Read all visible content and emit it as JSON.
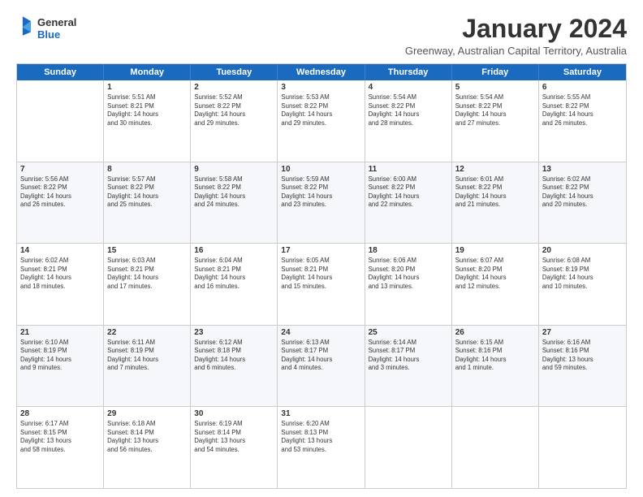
{
  "logo": {
    "general": "General",
    "blue": "Blue"
  },
  "title": "January 2024",
  "subtitle": "Greenway, Australian Capital Territory, Australia",
  "header_days": [
    "Sunday",
    "Monday",
    "Tuesday",
    "Wednesday",
    "Thursday",
    "Friday",
    "Saturday"
  ],
  "rows": [
    {
      "alt": false,
      "cells": [
        {
          "day": "",
          "info": ""
        },
        {
          "day": "1",
          "info": "Sunrise: 5:51 AM\nSunset: 8:21 PM\nDaylight: 14 hours\nand 30 minutes."
        },
        {
          "day": "2",
          "info": "Sunrise: 5:52 AM\nSunset: 8:22 PM\nDaylight: 14 hours\nand 29 minutes."
        },
        {
          "day": "3",
          "info": "Sunrise: 5:53 AM\nSunset: 8:22 PM\nDaylight: 14 hours\nand 29 minutes."
        },
        {
          "day": "4",
          "info": "Sunrise: 5:54 AM\nSunset: 8:22 PM\nDaylight: 14 hours\nand 28 minutes."
        },
        {
          "day": "5",
          "info": "Sunrise: 5:54 AM\nSunset: 8:22 PM\nDaylight: 14 hours\nand 27 minutes."
        },
        {
          "day": "6",
          "info": "Sunrise: 5:55 AM\nSunset: 8:22 PM\nDaylight: 14 hours\nand 26 minutes."
        }
      ]
    },
    {
      "alt": true,
      "cells": [
        {
          "day": "7",
          "info": "Sunrise: 5:56 AM\nSunset: 8:22 PM\nDaylight: 14 hours\nand 26 minutes."
        },
        {
          "day": "8",
          "info": "Sunrise: 5:57 AM\nSunset: 8:22 PM\nDaylight: 14 hours\nand 25 minutes."
        },
        {
          "day": "9",
          "info": "Sunrise: 5:58 AM\nSunset: 8:22 PM\nDaylight: 14 hours\nand 24 minutes."
        },
        {
          "day": "10",
          "info": "Sunrise: 5:59 AM\nSunset: 8:22 PM\nDaylight: 14 hours\nand 23 minutes."
        },
        {
          "day": "11",
          "info": "Sunrise: 6:00 AM\nSunset: 8:22 PM\nDaylight: 14 hours\nand 22 minutes."
        },
        {
          "day": "12",
          "info": "Sunrise: 6:01 AM\nSunset: 8:22 PM\nDaylight: 14 hours\nand 21 minutes."
        },
        {
          "day": "13",
          "info": "Sunrise: 6:02 AM\nSunset: 8:22 PM\nDaylight: 14 hours\nand 20 minutes."
        }
      ]
    },
    {
      "alt": false,
      "cells": [
        {
          "day": "14",
          "info": "Sunrise: 6:02 AM\nSunset: 8:21 PM\nDaylight: 14 hours\nand 18 minutes."
        },
        {
          "day": "15",
          "info": "Sunrise: 6:03 AM\nSunset: 8:21 PM\nDaylight: 14 hours\nand 17 minutes."
        },
        {
          "day": "16",
          "info": "Sunrise: 6:04 AM\nSunset: 8:21 PM\nDaylight: 14 hours\nand 16 minutes."
        },
        {
          "day": "17",
          "info": "Sunrise: 6:05 AM\nSunset: 8:21 PM\nDaylight: 14 hours\nand 15 minutes."
        },
        {
          "day": "18",
          "info": "Sunrise: 6:06 AM\nSunset: 8:20 PM\nDaylight: 14 hours\nand 13 minutes."
        },
        {
          "day": "19",
          "info": "Sunrise: 6:07 AM\nSunset: 8:20 PM\nDaylight: 14 hours\nand 12 minutes."
        },
        {
          "day": "20",
          "info": "Sunrise: 6:08 AM\nSunset: 8:19 PM\nDaylight: 14 hours\nand 10 minutes."
        }
      ]
    },
    {
      "alt": true,
      "cells": [
        {
          "day": "21",
          "info": "Sunrise: 6:10 AM\nSunset: 8:19 PM\nDaylight: 14 hours\nand 9 minutes."
        },
        {
          "day": "22",
          "info": "Sunrise: 6:11 AM\nSunset: 8:19 PM\nDaylight: 14 hours\nand 7 minutes."
        },
        {
          "day": "23",
          "info": "Sunrise: 6:12 AM\nSunset: 8:18 PM\nDaylight: 14 hours\nand 6 minutes."
        },
        {
          "day": "24",
          "info": "Sunrise: 6:13 AM\nSunset: 8:17 PM\nDaylight: 14 hours\nand 4 minutes."
        },
        {
          "day": "25",
          "info": "Sunrise: 6:14 AM\nSunset: 8:17 PM\nDaylight: 14 hours\nand 3 minutes."
        },
        {
          "day": "26",
          "info": "Sunrise: 6:15 AM\nSunset: 8:16 PM\nDaylight: 14 hours\nand 1 minute."
        },
        {
          "day": "27",
          "info": "Sunrise: 6:16 AM\nSunset: 8:16 PM\nDaylight: 13 hours\nand 59 minutes."
        }
      ]
    },
    {
      "alt": false,
      "cells": [
        {
          "day": "28",
          "info": "Sunrise: 6:17 AM\nSunset: 8:15 PM\nDaylight: 13 hours\nand 58 minutes."
        },
        {
          "day": "29",
          "info": "Sunrise: 6:18 AM\nSunset: 8:14 PM\nDaylight: 13 hours\nand 56 minutes."
        },
        {
          "day": "30",
          "info": "Sunrise: 6:19 AM\nSunset: 8:14 PM\nDaylight: 13 hours\nand 54 minutes."
        },
        {
          "day": "31",
          "info": "Sunrise: 6:20 AM\nSunset: 8:13 PM\nDaylight: 13 hours\nand 53 minutes."
        },
        {
          "day": "",
          "info": ""
        },
        {
          "day": "",
          "info": ""
        },
        {
          "day": "",
          "info": ""
        }
      ]
    }
  ]
}
